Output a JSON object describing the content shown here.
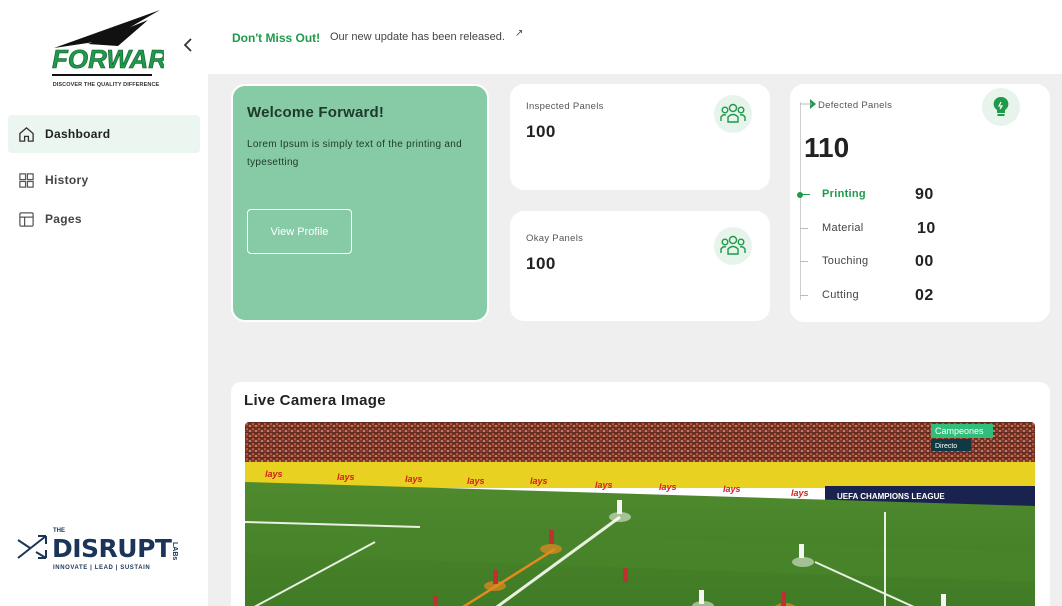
{
  "brand": {
    "logo_text": "FORWARD",
    "tagline": "DISCOVER THE QUALITY DIFFERENCE"
  },
  "sidebar": {
    "items": [
      {
        "label": "Dashboard",
        "icon": "home-icon",
        "active": true
      },
      {
        "label": "History",
        "icon": "grid-icon",
        "active": false
      },
      {
        "label": "Pages",
        "icon": "layout-icon",
        "active": false
      }
    ]
  },
  "partner": {
    "the": "THE",
    "name": "DISRUPT",
    "labs": "LABs",
    "slogan": "INNOVATE | LEAD | SUSTAIN"
  },
  "banner": {
    "highlight": "Don't Miss Out!",
    "message": "Our new update has been released.",
    "link_icon": "↗"
  },
  "welcome": {
    "title": "Welcome Forward!",
    "body": "Lorem Ipsum is simply text of the printing and typesetting",
    "button": "View Profile"
  },
  "stats": {
    "inspected": {
      "label": "Inspected Panels",
      "value": "100",
      "icon": "users-icon"
    },
    "okay": {
      "label": "Okay Panels",
      "value": "100",
      "icon": "users-icon"
    }
  },
  "defects": {
    "label": "Defected Panels",
    "total": "110",
    "icon": "lightbulb-icon",
    "rows": [
      {
        "name": "Printing",
        "value": "90"
      },
      {
        "name": "Material",
        "value": "10"
      },
      {
        "name": "Touching",
        "value": "00"
      },
      {
        "name": "Cutting",
        "value": "02"
      }
    ]
  },
  "camera": {
    "title": "Live Camera Image",
    "overlay_badge": "Campeones",
    "overlay_sub": "Directo",
    "board_text": "lays",
    "board_uefa": "UEFA CHAMPIONS LEAGUE"
  },
  "colors": {
    "accent": "#1e9a4a",
    "welcome_bg": "#86cba6",
    "page_bg": "#efefef"
  }
}
